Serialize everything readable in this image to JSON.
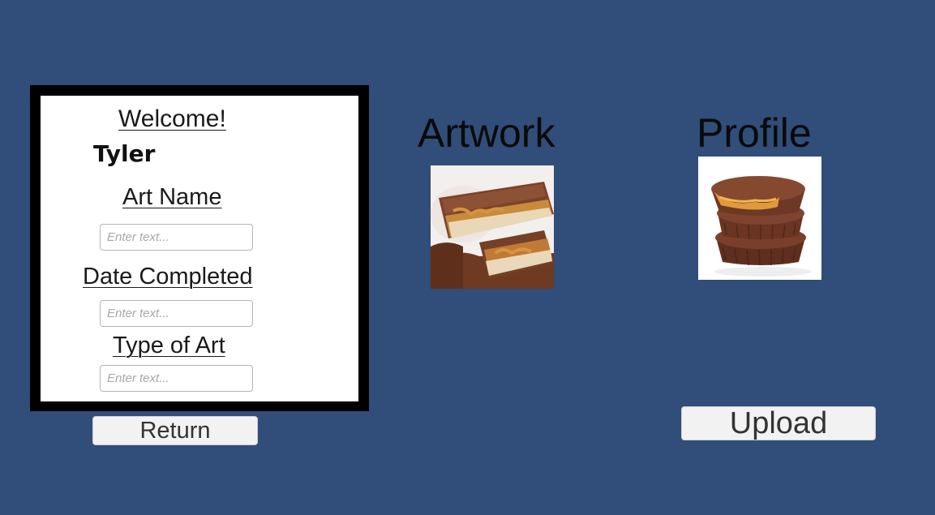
{
  "form": {
    "welcome_label": "Welcome!",
    "username": "Tyler",
    "art_name_label": "Art Name",
    "art_name_placeholder": "Enter text...",
    "art_name_value": "",
    "date_completed_label": "Date Completed",
    "date_completed_placeholder": "Enter text...",
    "date_completed_value": "",
    "type_of_art_label": "Type of Art",
    "type_of_art_placeholder": "Enter text...",
    "type_of_art_value": ""
  },
  "buttons": {
    "return_label": "Return",
    "upload_label": "Upload"
  },
  "artwork": {
    "heading": "Artwork",
    "image": "chocolate-caramel-bar-photo"
  },
  "profile": {
    "heading": "Profile",
    "image": "peanut-butter-cups-photo"
  },
  "colors": {
    "background": "#314d79",
    "panel_frame": "#000000",
    "panel": "#ffffff",
    "button": "#f2f2f2"
  }
}
